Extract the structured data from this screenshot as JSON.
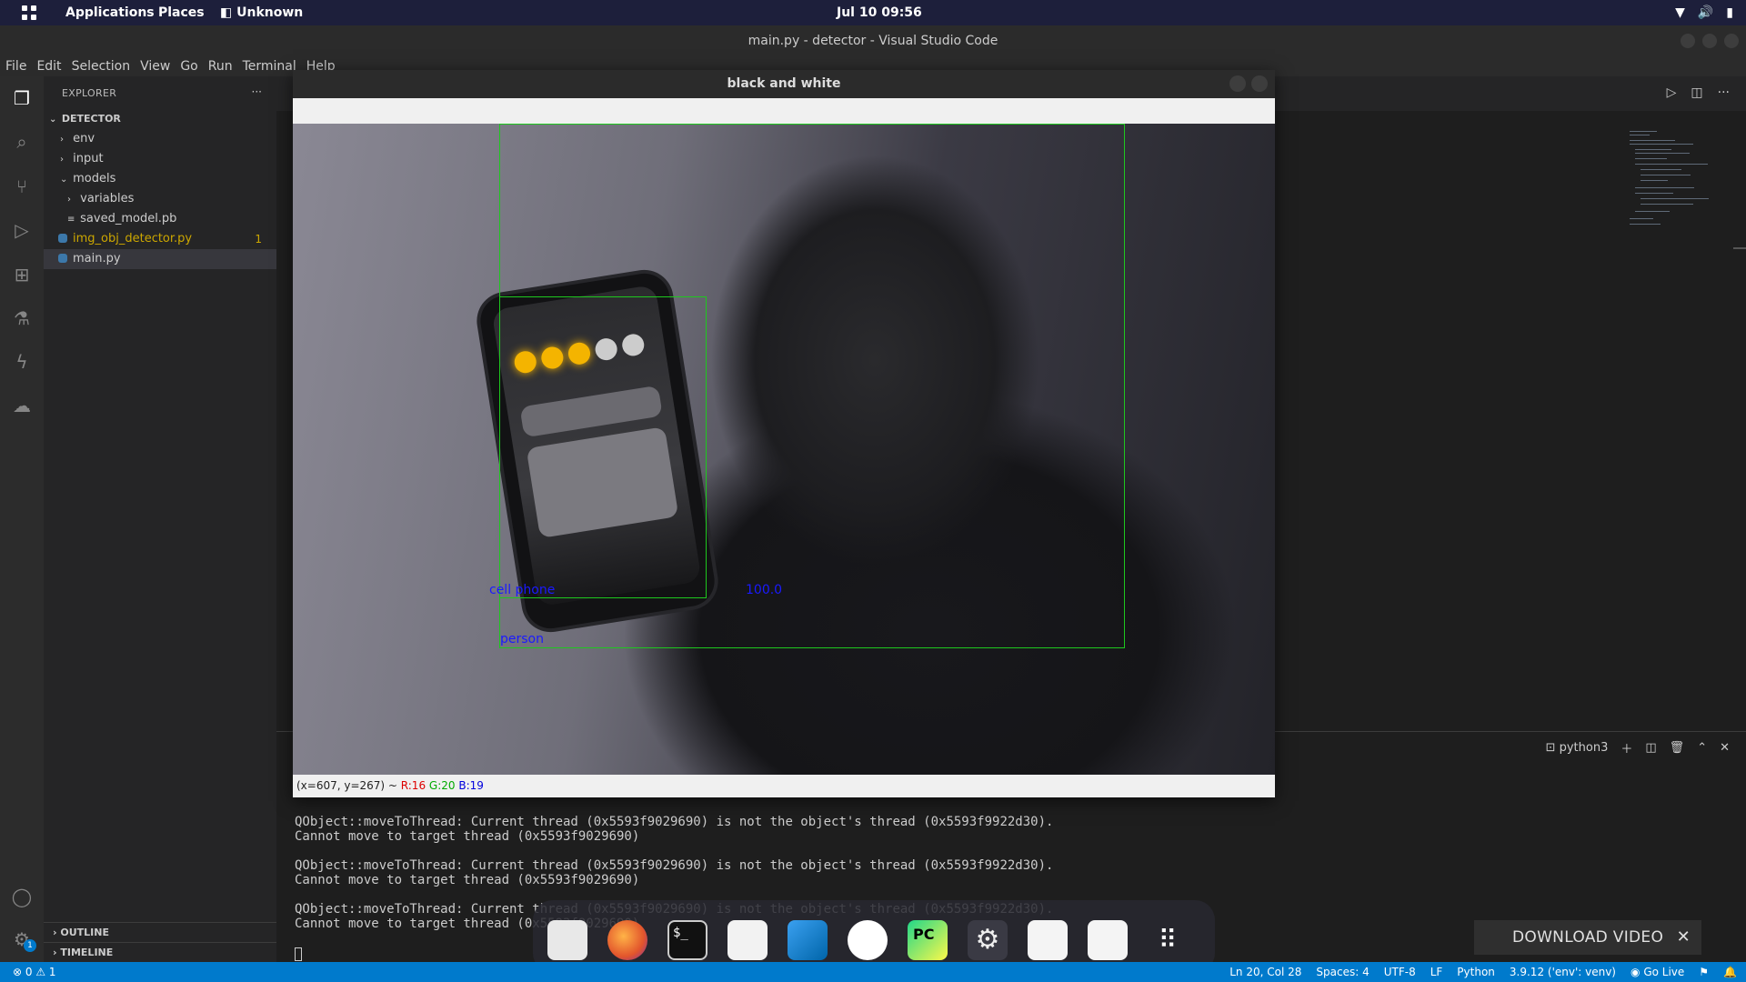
{
  "topbar": {
    "applications": "Applications",
    "places": "Places",
    "app_name": "Unknown",
    "clock": "Jul 10  09:56"
  },
  "window": {
    "title": "main.py - detector - Visual Studio Code"
  },
  "menu": [
    "File",
    "Edit",
    "Selection",
    "View",
    "Go",
    "Run",
    "Terminal",
    "Help"
  ],
  "sidebar": {
    "header": "EXPLORER",
    "more": "···",
    "project": "DETECTOR",
    "tree": [
      {
        "label": "env",
        "chev": "›",
        "indent": 1
      },
      {
        "label": "input",
        "chev": "›",
        "indent": 1
      },
      {
        "label": "models",
        "chev": "⌄",
        "indent": 1
      },
      {
        "label": "variables",
        "chev": "›",
        "indent": 2
      },
      {
        "label": "saved_model.pb",
        "chev": "≡",
        "indent": 2
      },
      {
        "label": "img_obj_detector.py",
        "badge": "1"
      },
      {
        "label": "main.py"
      }
    ],
    "outline": "OUTLINE",
    "timeline": "TIMELINE"
  },
  "cv_window": {
    "title": "black and white",
    "labels": {
      "phone": "cell phone",
      "phone_score": "100.0",
      "person": "person"
    },
    "status": {
      "coords": "(x=607, y=267) ~ ",
      "r": "R:16",
      "g": "G:20",
      "b": "B:19"
    }
  },
  "panel": {
    "shell": "python3",
    "lines": [
      "QObject::moveToThread: Current thread (0x5593f9029690) is not the object's thread (0x5593f9922d30).",
      "Cannot move to target thread (0x5593f9029690)",
      "",
      "QObject::moveToThread: Current thread (0x5593f9029690) is not the object's thread (0x5593f9922d30).",
      "Cannot move to target thread (0x5593f9029690)",
      "",
      "QObject::moveToThread: Current thread (0x5593f9029690) is not the object's thread (0x5593f9922d30).",
      "Cannot move to target thread (0x5593f9029690)"
    ]
  },
  "download": {
    "label": "DOWNLOAD VIDEO",
    "close": "✕"
  },
  "statusbar": {
    "problems": "⊗ 0 ⚠ 1",
    "position": "Ln 20, Col 28",
    "spaces": "Spaces: 4",
    "encoding": "UTF-8",
    "eol": "LF",
    "language": "Python",
    "interpreter": "3.9.12 ('env': venv)",
    "golive": "Go Live"
  },
  "colors": {
    "accent": "#007acc",
    "bbox": "#1ec81e",
    "label": "#1a1aff"
  }
}
